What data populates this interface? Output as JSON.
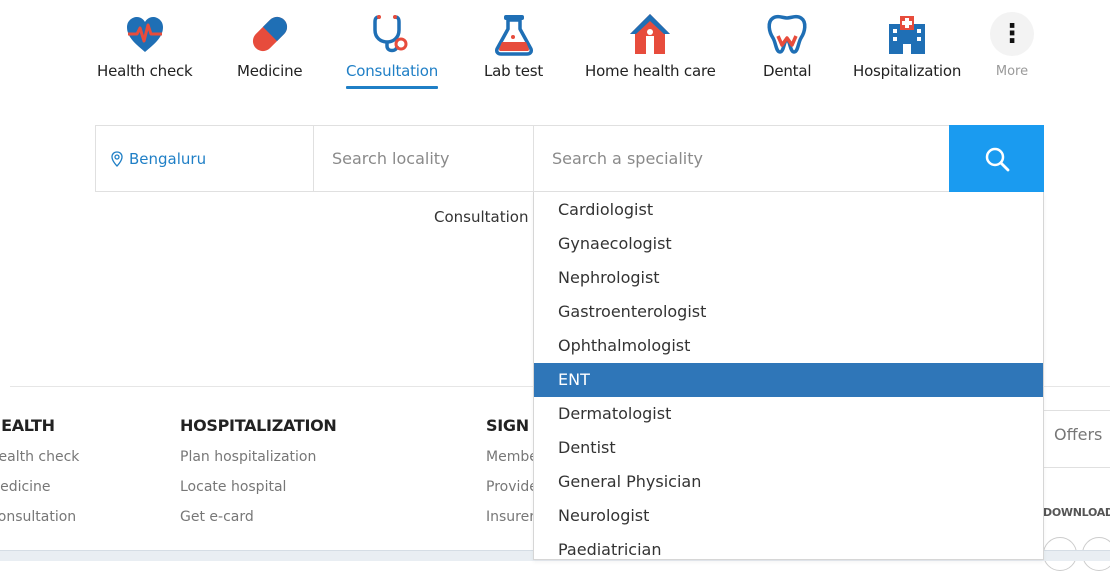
{
  "nav": {
    "items": [
      {
        "label": "Health check",
        "icon": "heart-pulse-icon"
      },
      {
        "label": "Medicine",
        "icon": "capsule-icon"
      },
      {
        "label": "Consultation",
        "icon": "stethoscope-icon",
        "active": true
      },
      {
        "label": "Lab test",
        "icon": "flask-icon"
      },
      {
        "label": "Home health care",
        "icon": "home-care-icon"
      },
      {
        "label": "Dental",
        "icon": "tooth-icon"
      },
      {
        "label": "Hospitalization",
        "icon": "hospital-icon"
      }
    ],
    "more_label": "More",
    "accent_color": "#1f7fc6"
  },
  "search": {
    "city": "Bengaluru",
    "locality_placeholder": "Search locality",
    "speciality_placeholder": "Search a speciality",
    "button_color": "#1a9bf0"
  },
  "dropdown": {
    "items": [
      "Cardiologist",
      "Gynaecologist",
      "Nephrologist",
      "Gastroenterologist",
      "Ophthalmologist",
      "ENT",
      "Dermatologist",
      "Dentist",
      "General Physician",
      "Neurologist",
      "Paediatrician"
    ],
    "selected": "ENT",
    "selected_color": "#2f76b8"
  },
  "behind": {
    "consultation_text": "Consultation"
  },
  "footer": {
    "col1": {
      "heading": "HEALTH",
      "links": [
        "Health check",
        "Medicine",
        "Consultation"
      ]
    },
    "col2": {
      "heading": "HOSPITALIZATION",
      "links": [
        "Plan hospitalization",
        "Locate hospital",
        "Get e-card"
      ]
    },
    "col3": {
      "heading": "SIGN IN",
      "links": [
        "Member",
        "Provider",
        "Insurer"
      ]
    },
    "offers_label": "Offers",
    "download_label": "DOWNLOAD APP"
  }
}
